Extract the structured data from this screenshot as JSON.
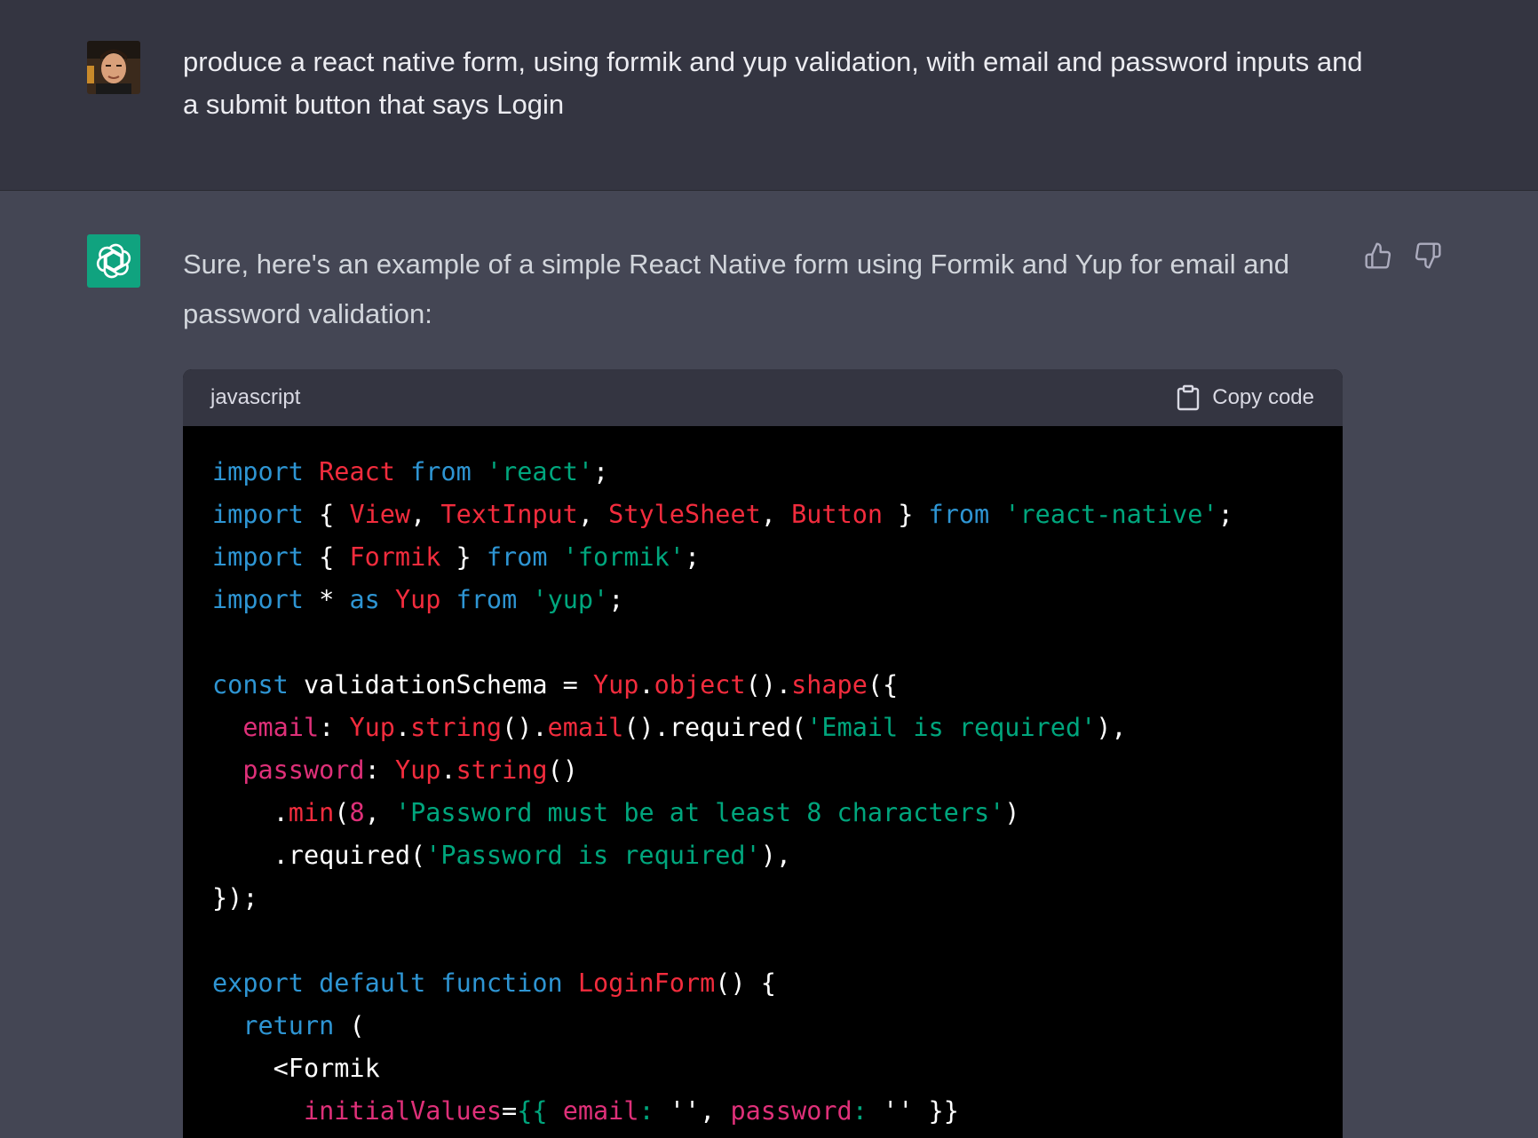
{
  "user_message": {
    "text": "produce a react native form, using formik and yup validation, with email and password inputs and a submit button that says Login"
  },
  "assistant_message": {
    "text": "Sure, here's an example of a simple React Native form using Formik and Yup for email and password validation:"
  },
  "code_block": {
    "language": "javascript",
    "copy_label": "Copy code",
    "lines": [
      [
        [
          "k",
          "import"
        ],
        [
          "w",
          " "
        ],
        [
          "r",
          "React"
        ],
        [
          "w",
          " "
        ],
        [
          "k",
          "from"
        ],
        [
          "w",
          " "
        ],
        [
          "s",
          "'react'"
        ],
        [
          "w",
          ";"
        ]
      ],
      [
        [
          "k",
          "import"
        ],
        [
          "w",
          " { "
        ],
        [
          "r",
          "View"
        ],
        [
          "w",
          ", "
        ],
        [
          "r",
          "TextInput"
        ],
        [
          "w",
          ", "
        ],
        [
          "r",
          "StyleSheet"
        ],
        [
          "w",
          ", "
        ],
        [
          "r",
          "Button"
        ],
        [
          "w",
          " } "
        ],
        [
          "k",
          "from"
        ],
        [
          "w",
          " "
        ],
        [
          "s",
          "'react-native'"
        ],
        [
          "w",
          ";"
        ]
      ],
      [
        [
          "k",
          "import"
        ],
        [
          "w",
          " { "
        ],
        [
          "r",
          "Formik"
        ],
        [
          "w",
          " } "
        ],
        [
          "k",
          "from"
        ],
        [
          "w",
          " "
        ],
        [
          "s",
          "'formik'"
        ],
        [
          "w",
          ";"
        ]
      ],
      [
        [
          "k",
          "import"
        ],
        [
          "w",
          " * "
        ],
        [
          "k",
          "as"
        ],
        [
          "w",
          " "
        ],
        [
          "r",
          "Yup"
        ],
        [
          "w",
          " "
        ],
        [
          "k",
          "from"
        ],
        [
          "w",
          " "
        ],
        [
          "s",
          "'yup'"
        ],
        [
          "w",
          ";"
        ]
      ],
      [],
      [
        [
          "k",
          "const"
        ],
        [
          "w",
          " validationSchema = "
        ],
        [
          "r",
          "Yup"
        ],
        [
          "w",
          "."
        ],
        [
          "r",
          "object"
        ],
        [
          "w",
          "()."
        ],
        [
          "r",
          "shape"
        ],
        [
          "w",
          "({"
        ]
      ],
      [
        [
          "w",
          "  "
        ],
        [
          "p",
          "email"
        ],
        [
          "w",
          ": "
        ],
        [
          "r",
          "Yup"
        ],
        [
          "w",
          "."
        ],
        [
          "r",
          "string"
        ],
        [
          "w",
          "()."
        ],
        [
          "r",
          "email"
        ],
        [
          "w",
          "().required("
        ],
        [
          "s",
          "'Email is required'"
        ],
        [
          "w",
          "),"
        ]
      ],
      [
        [
          "w",
          "  "
        ],
        [
          "p",
          "password"
        ],
        [
          "w",
          ": "
        ],
        [
          "r",
          "Yup"
        ],
        [
          "w",
          "."
        ],
        [
          "r",
          "string"
        ],
        [
          "w",
          "()"
        ]
      ],
      [
        [
          "w",
          "    ."
        ],
        [
          "r",
          "min"
        ],
        [
          "w",
          "("
        ],
        [
          "n",
          "8"
        ],
        [
          "w",
          ", "
        ],
        [
          "s",
          "'Password must be at least 8 characters'"
        ],
        [
          "w",
          ")"
        ]
      ],
      [
        [
          "w",
          "    .required("
        ],
        [
          "s",
          "'Password is required'"
        ],
        [
          "w",
          "),"
        ]
      ],
      [
        [
          "w",
          "});"
        ]
      ],
      [],
      [
        [
          "k",
          "export"
        ],
        [
          "w",
          " "
        ],
        [
          "k",
          "default"
        ],
        [
          "w",
          " "
        ],
        [
          "k",
          "function"
        ],
        [
          "w",
          " "
        ],
        [
          "r",
          "LoginForm"
        ],
        [
          "w",
          "() {"
        ]
      ],
      [
        [
          "w",
          "  "
        ],
        [
          "k",
          "return"
        ],
        [
          "w",
          " ("
        ]
      ],
      [
        [
          "w",
          "    <Formik"
        ]
      ],
      [
        [
          "w",
          "      "
        ],
        [
          "p",
          "initialValues"
        ],
        [
          "w",
          "="
        ],
        [
          "s",
          "{{"
        ],
        [
          "w",
          " "
        ],
        [
          "p",
          "email"
        ],
        [
          "s",
          ":"
        ],
        [
          "w",
          " '', "
        ],
        [
          "p",
          "password"
        ],
        [
          "s",
          ":"
        ],
        [
          "w",
          " '' }}"
        ]
      ]
    ]
  },
  "colors": {
    "user_bg": "#343541",
    "assistant_bg": "#444654",
    "brand_green": "#10a37f",
    "code_bg": "#000000"
  }
}
